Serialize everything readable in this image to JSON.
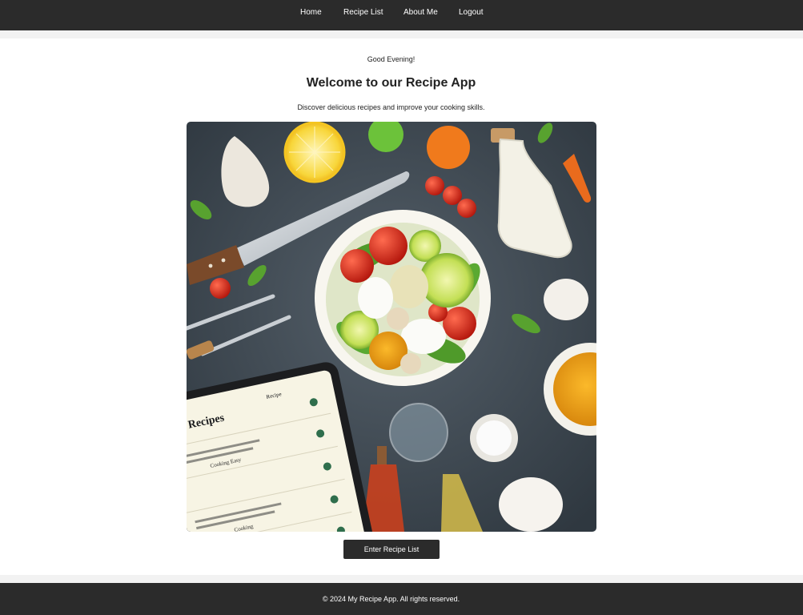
{
  "nav": {
    "items": [
      {
        "label": "Home"
      },
      {
        "label": "Recipe List"
      },
      {
        "label": "About Me"
      },
      {
        "label": "Logout"
      }
    ]
  },
  "main": {
    "greeting": "Good Evening!",
    "title": "Welcome to our Recipe App",
    "subtitle": "Discover delicious recipes and improve your cooking skills.",
    "hero": {
      "tablet_heading": "Recipes",
      "tablet_tab": "Recipe",
      "tablet_items": [
        "Cooking Easy",
        "Cooking"
      ]
    },
    "button_label": "Enter Recipe List"
  },
  "footer": {
    "text": "© 2024 My Recipe App. All rights reserved."
  },
  "colors": {
    "nav_bg": "#2b2b2b",
    "page_bg": "#f2f2f2",
    "card_bg": "#ffffff",
    "button_bg": "#2b2b2b",
    "hero_table": "#3f4a55"
  }
}
